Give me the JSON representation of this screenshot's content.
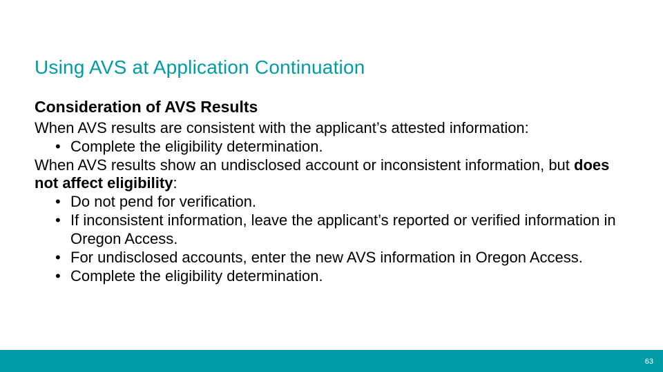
{
  "title": "Using AVS at Application Continuation",
  "subheading": "Consideration of AVS Results",
  "para1": "When AVS results are consistent with the applicant’s attested information:",
  "list1": [
    "Complete the eligibility determination."
  ],
  "para2_pre": "When AVS results show an undisclosed account or inconsistent information, but ",
  "para2_bold": "does not affect eligibility",
  "para2_post": ":",
  "list2": [
    "Do not pend for verification.",
    "If inconsistent information, leave the applicant’s reported or verified information in Oregon Access.",
    "For undisclosed accounts, enter the new AVS information in Oregon Access.",
    "Complete the eligibility determination."
  ],
  "page_number": "63"
}
